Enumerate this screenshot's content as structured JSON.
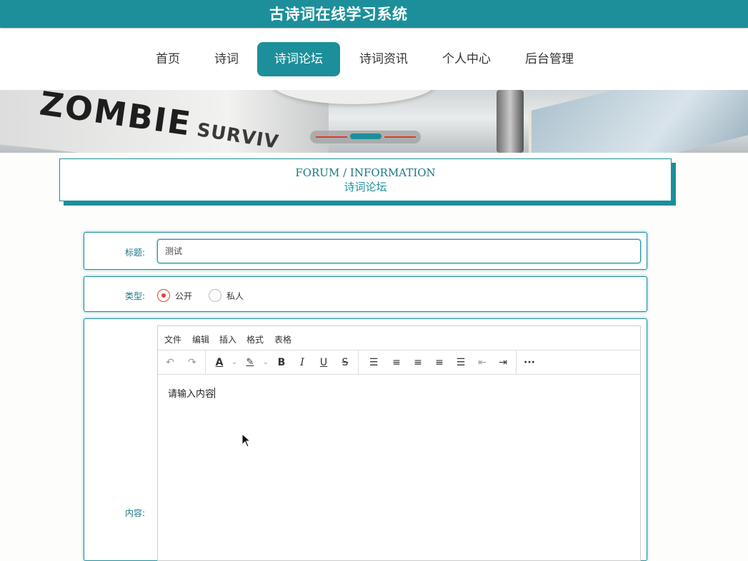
{
  "header": {
    "title": "古诗词在线学习系统"
  },
  "nav": {
    "items": [
      {
        "label": "首页"
      },
      {
        "label": "诗词"
      },
      {
        "label": "诗词论坛"
      },
      {
        "label": "诗词资讯"
      },
      {
        "label": "个人中心"
      },
      {
        "label": "后台管理"
      }
    ],
    "active": "诗词论坛"
  },
  "banner": {
    "text_1": "ZOMBIE",
    "text_2": "SURVIV",
    "slide_count": 3,
    "active_slide": 2
  },
  "section": {
    "title_en": "FORUM / INFORMATION",
    "title_cn": "诗词论坛"
  },
  "form": {
    "title_label": "标题:",
    "title_value": "测试",
    "type_label": "类型:",
    "type_options": [
      "公开",
      "私人"
    ],
    "type_selected": "公开",
    "content_label": "内容:"
  },
  "editor": {
    "menus": [
      "文件",
      "编辑",
      "插入",
      "格式",
      "表格"
    ],
    "toolbar": [
      "undo-icon",
      "redo-icon",
      "text-color-icon",
      "highlight-icon",
      "bold-icon",
      "italic-icon",
      "underline-icon",
      "strikethrough-icon",
      "line-height-icon",
      "align-left-icon",
      "align-center-icon",
      "align-right-icon",
      "align-justify-icon",
      "outdent-icon",
      "indent-icon",
      "more-icon"
    ],
    "content": "请输入内容"
  },
  "colors": {
    "accent": "#1d8f9a",
    "radio": "#e0463a"
  }
}
